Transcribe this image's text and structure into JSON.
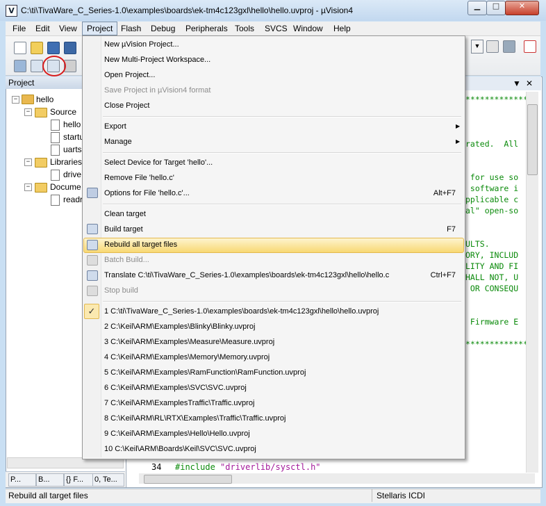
{
  "window": {
    "title": "C:\\ti\\TivaWare_C_Series-1.0\\examples\\boards\\ek-tm4c123gxl\\hello\\hello.uvproj - µVision4",
    "app_icon_glyph": "V",
    "min_glyph": "▁",
    "max_glyph": "□",
    "close_glyph": "✕"
  },
  "menubar": [
    "File",
    "Edit",
    "View",
    "Project",
    "Flash",
    "Debug",
    "Peripherals",
    "Tools",
    "SVCS",
    "Window",
    "Help"
  ],
  "project_pane": {
    "title": "Project",
    "tree": {
      "root": "hello",
      "source": "Source",
      "source_files": [
        "hello",
        "startu",
        "uarts"
      ],
      "libraries": "Libraries",
      "library_files": [
        "drive"
      ],
      "documentation": "Docume",
      "doc_files": [
        "readr"
      ]
    },
    "tabs": [
      "P...",
      "B...",
      "{} F...",
      "0, Te..."
    ]
  },
  "editor": {
    "pin_glyph": "▼",
    "close_glyph": "✕",
    "code_lines": [
      "*************",
      "",
      "",
      "rated.  All",
      "",
      "",
      " for use so",
      " software i",
      "pplicable c",
      "al\" open-so",
      "",
      "",
      "ULTS.",
      "ORY, INCLUD",
      "LITY AND FI",
      "HALL NOT, U",
      " OR CONSEQU",
      "",
      "",
      " Firmware E",
      "",
      "*************"
    ],
    "line_number": "34",
    "include_keyword": "#include ",
    "include_string": "\"driverlib/sysctl.h\""
  },
  "project_menu": {
    "items_group1": [
      "New µVision Project...",
      "New Multi-Project Workspace...",
      "Open Project...",
      "Save Project in µVision4 format",
      "Close Project"
    ],
    "items_group2": [
      "Export",
      "Manage"
    ],
    "items_group3": [
      "Select Device for Target 'hello'...",
      "Remove File 'hello.c'",
      "Options for File 'hello.c'..."
    ],
    "options_shortcut": "Alt+F7",
    "items_group4": [
      "Clean target",
      "Build target",
      "Rebuild all target files",
      "Batch Build...",
      "Translate C:\\ti\\TivaWare_C_Series-1.0\\examples\\boards\\ek-tm4c123gxl\\hello\\hello.c",
      "Stop build"
    ],
    "build_shortcut": "F7",
    "translate_shortcut": "Ctrl+F7",
    "recent_projects": [
      "1 C:\\ti\\TivaWare_C_Series-1.0\\examples\\boards\\ek-tm4c123gxl\\hello\\hello.uvproj",
      "2 C:\\Keil\\ARM\\Examples\\Blinky\\Blinky.uvproj",
      "3 C:\\Keil\\ARM\\Examples\\Measure\\Measure.uvproj",
      "4 C:\\Keil\\ARM\\Examples\\Memory\\Memory.uvproj",
      "5 C:\\Keil\\ARM\\Examples\\RamFunction\\RamFunction.uvproj",
      "6 C:\\Keil\\ARM\\Examples\\SVC\\SVC.uvproj",
      "7 C:\\Keil\\ARM\\ExamplesTraffic\\Traffic.uvproj",
      "8 C:\\Keil\\ARM\\RL\\RTX\\Examples\\Traffic\\Traffic.uvproj",
      "9 C:\\Keil\\ARM\\Examples\\Hello\\Hello.uvproj",
      "10 C:\\Keil\\ARM\\Boards\\Keil\\SVC\\SVC.uvproj"
    ],
    "submenu_arrow": "▶",
    "check_glyph": "✓"
  },
  "statusbar": {
    "left": "Rebuild all target files",
    "right": "Stellaris ICDI"
  }
}
